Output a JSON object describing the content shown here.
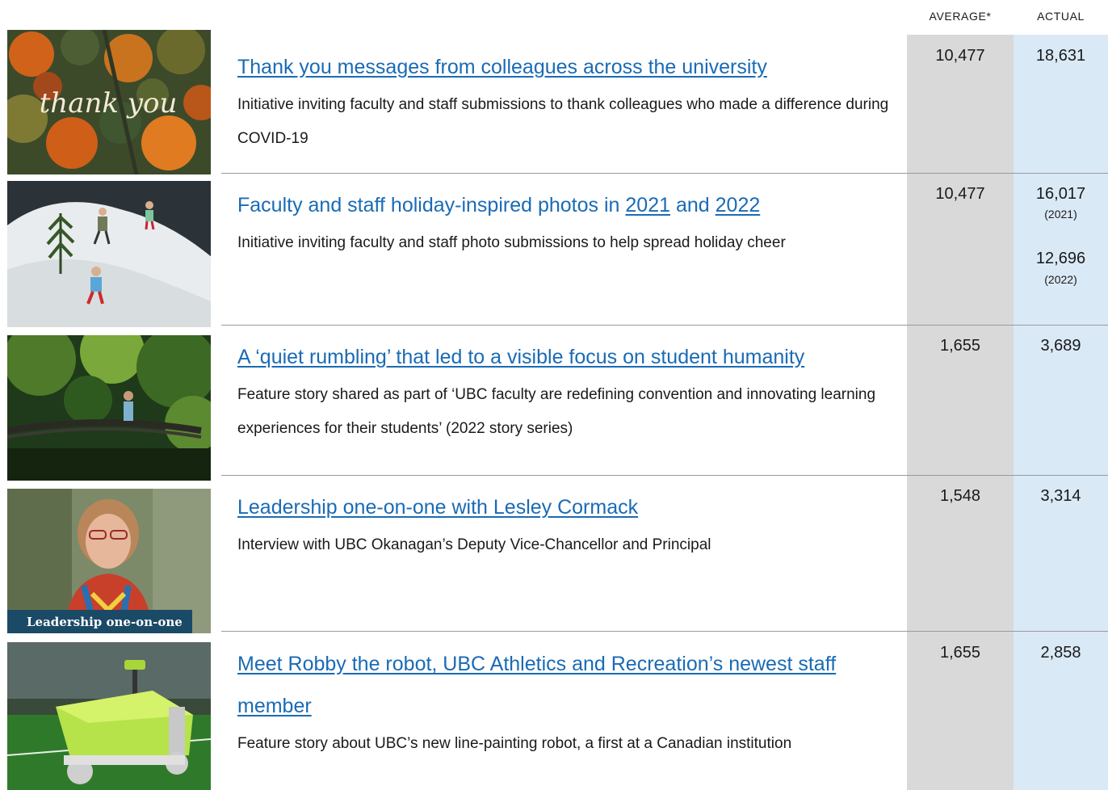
{
  "header": {
    "average_label": "AVERAGE*",
    "actual_label": "ACTUAL"
  },
  "rows": [
    {
      "title": "Thank you messages from colleagues across the university",
      "description": "Initiative inviting faculty and staff submissions to thank colleagues who made a difference during COVID-19",
      "average": "10,477",
      "actual": "18,631",
      "thumb_text": "thank you"
    },
    {
      "title_prefix": "Faculty and staff holiday-inspired photos in",
      "title_link1": "2021",
      "title_and": "and",
      "title_link2": "2022",
      "description": "Initiative inviting faculty and staff photo submissions to help spread holiday cheer",
      "average": "10,477",
      "actual_1": "16,017",
      "actual_1_year": "(2021)",
      "actual_2": "12,696",
      "actual_2_year": "(2022)"
    },
    {
      "title": "A ‘quiet rumbling’ that led to a visible focus on student humanity",
      "description": "Feature story shared as part of ‘UBC faculty are redefining convention and innovating learning experiences for their students’ (2022 story series)",
      "average": "1,655",
      "actual": "3,689"
    },
    {
      "title": "Leadership one-on-one with Lesley Cormack",
      "description": "Interview with UBC Okanagan’s Deputy Vice-Chancellor and Principal",
      "average": "1,548",
      "actual": "3,314",
      "thumb_badge": "Leadership one-on-one"
    },
    {
      "title": "Meet Robby the robot, UBC Athletics and Recreation’s newest staff member",
      "description": "Feature story about UBC’s new line-painting robot, a first at a Canadian institution",
      "average": "1,655",
      "actual": "2,858"
    }
  ]
}
